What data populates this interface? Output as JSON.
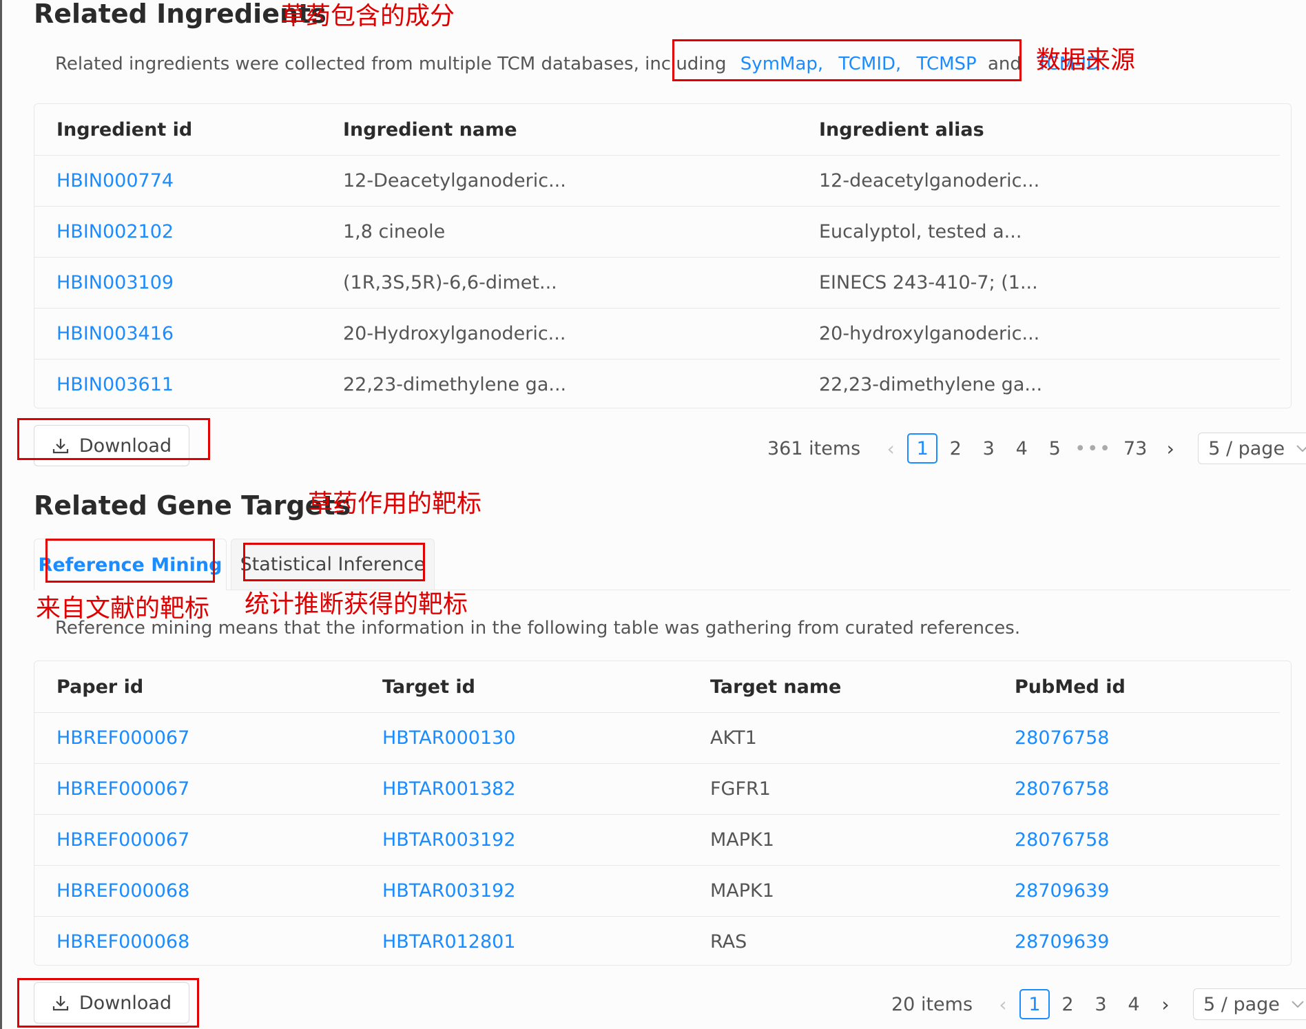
{
  "ingredients_section": {
    "title": "Related Ingredients",
    "title_note": "草药包含的成分",
    "description_prefix": "Related ingredients were collected from multiple TCM databases, including",
    "sources": [
      "SymMap,",
      "TCMID,",
      "TCMSP",
      "TCM-ID."
    ],
    "sources_conjunction": "and",
    "sources_note": "数据来源",
    "table": {
      "columns": [
        "Ingredient id",
        "Ingredient name",
        "Ingredient alias"
      ],
      "rows": [
        [
          "HBIN000774",
          "12-Deacetylganoderic...",
          "12-deacetylganoderic..."
        ],
        [
          "HBIN002102",
          "1,8 cineole",
          "Eucalyptol, tested a..."
        ],
        [
          "HBIN003109",
          "(1R,3S,5R)-6,6-dimet...",
          "EINECS 243-410-7; (1..."
        ],
        [
          "HBIN003416",
          "20-Hydroxylganoderic...",
          "20-hydroxylganoderic..."
        ],
        [
          "HBIN003611",
          "22,23-dimethylene ga...",
          "22,23-dimethylene ga..."
        ]
      ]
    },
    "download_label": "Download",
    "pagination": {
      "total": "361 items",
      "pages": [
        "1",
        "2",
        "3",
        "4",
        "5",
        "•••",
        "73"
      ],
      "current": "1",
      "page_size": "5 / page"
    }
  },
  "targets_section": {
    "title": "Related Gene Targets",
    "title_note": "草药作用的靶标",
    "tabs": [
      {
        "label": "Reference Mining",
        "note": "来自文献的靶标"
      },
      {
        "label": "Statistical Inference",
        "note": "统计推断获得的靶标"
      }
    ],
    "description": "Reference mining means that the information in the following table was gathering from curated references.",
    "table": {
      "columns": [
        "Paper id",
        "Target id",
        "Target name",
        "PubMed id"
      ],
      "rows": [
        [
          "HBREF000067",
          "HBTAR000130",
          "AKT1",
          "28076758"
        ],
        [
          "HBREF000067",
          "HBTAR001382",
          "FGFR1",
          "28076758"
        ],
        [
          "HBREF000067",
          "HBTAR003192",
          "MAPK1",
          "28076758"
        ],
        [
          "HBREF000068",
          "HBTAR003192",
          "MAPK1",
          "28709639"
        ],
        [
          "HBREF000068",
          "HBTAR012801",
          "RAS",
          "28709639"
        ]
      ]
    },
    "download_label": "Download",
    "pagination": {
      "total": "20 items",
      "pages": [
        "1",
        "2",
        "3",
        "4"
      ],
      "current": "1",
      "page_size": "5 / page"
    }
  },
  "colors": {
    "link": "#1a8cff",
    "annotation": "#e00000"
  },
  "icons": {
    "download": "download-icon",
    "prev": "chevron-left-icon",
    "next": "chevron-right-icon",
    "dropdown": "chevron-down-icon"
  }
}
